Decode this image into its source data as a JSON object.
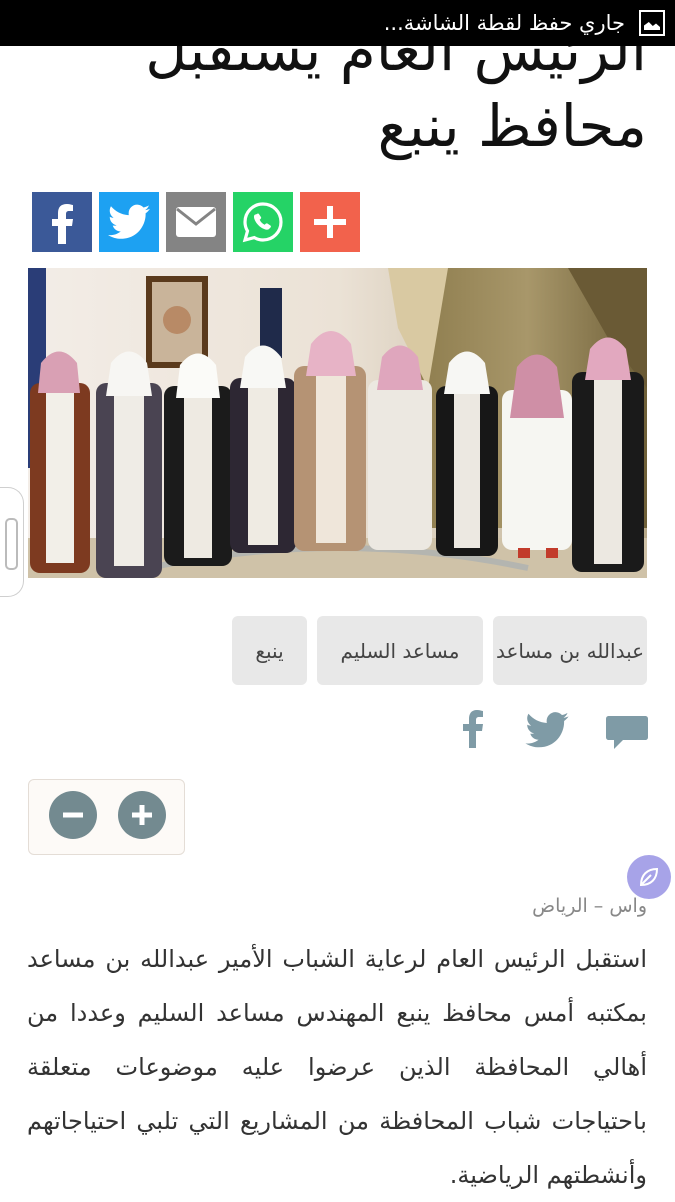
{
  "status_bar": {
    "notification": "جاري حفظ لقطة الشاشة...",
    "icon": "screenshot-icon"
  },
  "article": {
    "title": "الرئيس العام يستقبل محافظ ينبع",
    "photo_alt": "",
    "tags": [
      "عبدالله بن مساعد",
      "مساعد السليم",
      "ينبع"
    ],
    "source": "واس – الرياض",
    "body": "استقبل الرئيس العام لرعاية الشباب الأمير عبدالله بن مساعد بمكتبه أمس محافظ ينبع المهندس مساعد السليم وعددا من أهالي المحافظة الذين عرضوا عليه موضوعات متعلقة باحتياجات شباب المحافظة من المشاريع التي تلبي احتياجاتهم وأنشطتهم الرياضية."
  },
  "share_buttons": [
    {
      "name": "facebook",
      "color": "#3b5998"
    },
    {
      "name": "twitter",
      "color": "#1da1f2"
    },
    {
      "name": "email",
      "color": "#848484"
    },
    {
      "name": "whatsapp",
      "color": "#25d366"
    },
    {
      "name": "more",
      "color": "#f2624c"
    }
  ],
  "social_icons": [
    "comment-icon",
    "twitter-icon",
    "facebook-icon"
  ],
  "font_controls": {
    "decrease": "minus-icon",
    "increase": "plus-icon"
  }
}
